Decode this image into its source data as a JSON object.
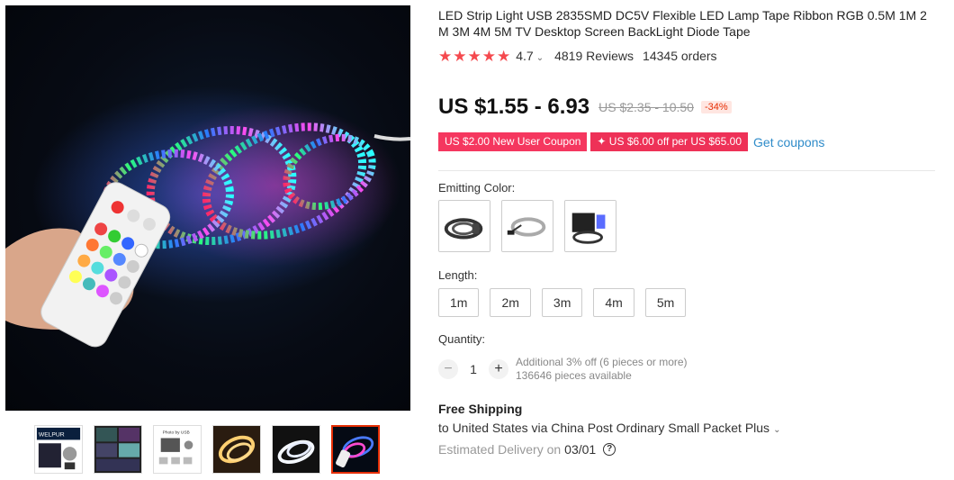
{
  "gallery": {
    "main_image_alt": "led-strip-with-remote",
    "thumbnails": [
      {
        "icon": "thumb-package",
        "logo_text": "WELPUR"
      },
      {
        "icon": "thumb-room-scenes"
      },
      {
        "icon": "thumb-package-list",
        "label": "Photo by USB"
      },
      {
        "icon": "thumb-warm-strip"
      },
      {
        "icon": "thumb-white-strip"
      },
      {
        "icon": "thumb-rgb-remote",
        "active": true
      }
    ]
  },
  "product": {
    "title": "LED Strip Light USB 2835SMD DC5V Flexible LED Lamp Tape Ribbon RGB 0.5M 1M 2 M 3M 4M 5M TV Desktop Screen BackLight Diode Tape",
    "rating": "4.7",
    "reviews": "4819 Reviews",
    "orders": "14345 orders",
    "star_count": 5
  },
  "price": {
    "current": "US $1.55 - 6.93",
    "original": "US $2.35 - 10.50",
    "discount": "-34%"
  },
  "coupons": {
    "new_user": "US $2.00 New User Coupon",
    "store": "✦ US $6.00 off per US $65.00",
    "get_link": "Get coupons"
  },
  "options": {
    "color_label": "Emitting Color:",
    "colors": [
      "color-option-rgb-remote",
      "color-option-usb-plug",
      "color-option-package-box"
    ],
    "length_label": "Length:",
    "lengths": [
      "1m",
      "2m",
      "3m",
      "4m",
      "5m"
    ]
  },
  "quantity": {
    "label": "Quantity:",
    "value": "1",
    "minus": "−",
    "plus": "+",
    "bulk_offer": "Additional 3% off (6 pieces or more)",
    "available": "136646 pieces available"
  },
  "shipping": {
    "title": "Free Shipping",
    "destination": "to United States via China Post Ordinary Small Packet Plus",
    "delivery_label": "Estimated Delivery on",
    "delivery_date": "03/01",
    "help": "?"
  },
  "colors": {
    "accent": "#e62e04",
    "coupon_pink": "#f5375f",
    "link_blue": "#2e8bc9",
    "star_red": "#f5494e"
  }
}
